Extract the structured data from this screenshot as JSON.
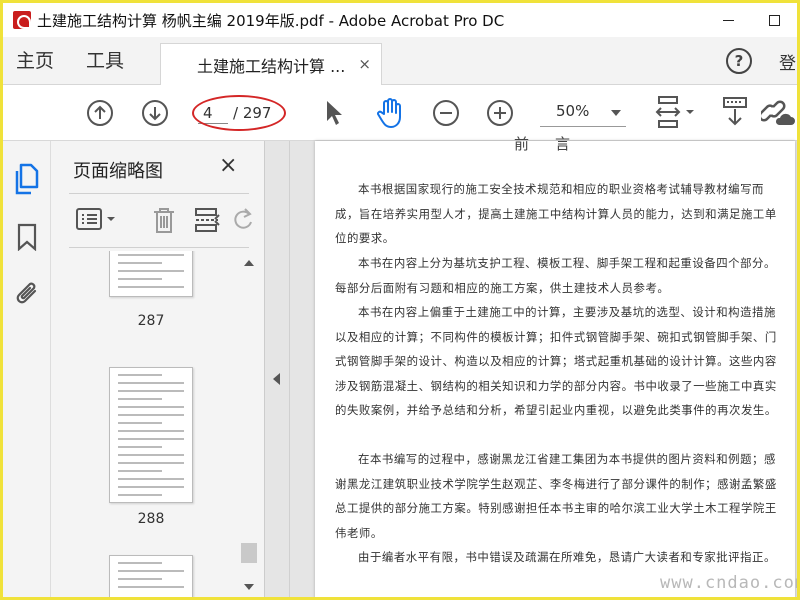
{
  "window": {
    "title": "土建施工结构计算 杨帆主编 2019年版.pdf - Adobe Acrobat Pro DC"
  },
  "tabs": {
    "home": "主页",
    "tools": "工具",
    "document": "土建施工结构计算 ...",
    "document_close": "×",
    "help": "?",
    "signin": "登"
  },
  "toolbar": {
    "current_page": "4",
    "total_pages": "/ 297",
    "zoom": "50%"
  },
  "panel": {
    "title": "页面缩略图",
    "close": "×",
    "thumbnails": [
      {
        "label": "287"
      },
      {
        "label": "288"
      }
    ]
  },
  "document": {
    "heading": "前言",
    "paragraphs": [
      "本书根据国家现行的施工安全技术规范和相应的职业资格考试辅导教材编写而成，旨在培养实用型人才，提高土建施工中结构计算人员的能力，达到和满足施工单位的要求。",
      "本书在内容上分为基坑支护工程、模板工程、脚手架工程和起重设备四个部分。每部分后面附有习题和相应的施工方案，供土建技术人员参考。",
      "本书在内容上偏重于土建施工中的计算，主要涉及基坑的选型、设计和构造措施以及相应的计算；不同构件的模板计算；扣件式钢管脚手架、碗扣式钢管脚手架、门式钢管脚手架的设计、构造以及相应的计算；塔式起重机基础的设计计算。这些内容涉及钢筋混凝土、钢结构的相关知识和力学的部分内容。书中收录了一些施工中真实的失败案例，并给予总结和分析，希望引起业内重视，以避免此类事件的再次发生。",
      "在本书编写的过程中，感谢黑龙江省建工集团为本书提供的图片资料和例题；感谢黑龙江建筑职业技术学院学生赵观芷、李冬梅进行了部分课件的制作；感谢孟繁盛总工提供的部分施工方案。特别感谢担任本书主审的哈尔滨工业大学土木工程学院王伟老师。",
      "由于编者水平有限，书中错误及疏漏在所难免，恳请广大读者和专家批评指正。"
    ],
    "watermark": "www.cndao.com"
  },
  "colors": {
    "border_highlight": "#f0e23a",
    "annotation_ellipse": "#d42626",
    "hand_tool_active": "#1473e6",
    "rail_active": "#1473e6"
  }
}
